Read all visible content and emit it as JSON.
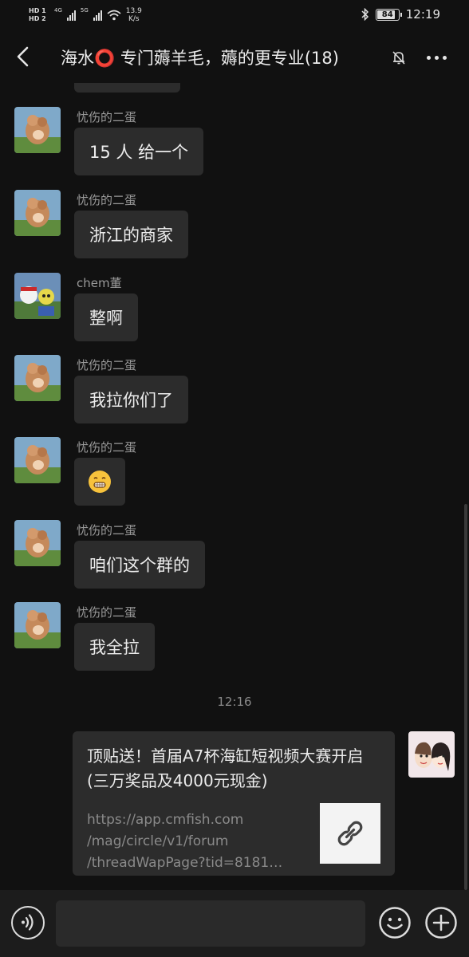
{
  "status_bar": {
    "sim1": "HD 1",
    "sim2": "HD 2",
    "net1": "4G",
    "net2": "5G",
    "speed_value": "13.9",
    "speed_unit": "K/s",
    "battery": "84",
    "time": "12:19"
  },
  "header": {
    "title": "海水⭕ 专门薅羊毛，薅的更专业(18)",
    "back_icon": "back-arrow-icon",
    "mute_icon": "bell-muted-icon",
    "more_icon": "more-dots-icon"
  },
  "messages": [
    {
      "sender": "忧伤的二蛋",
      "text": "15 人 给一个",
      "avatar": "teddy-avatar"
    },
    {
      "sender": "忧伤的二蛋",
      "text": "浙江的商家",
      "avatar": "teddy-avatar"
    },
    {
      "sender": "chem董",
      "text": "整啊",
      "avatar": "cartoon-avatar"
    },
    {
      "sender": "忧伤的二蛋",
      "text": "我拉你们了",
      "avatar": "teddy-avatar"
    },
    {
      "sender": "忧伤的二蛋",
      "text": "",
      "emoji": "grinning-face-emoji",
      "avatar": "teddy-avatar"
    },
    {
      "sender": "忧伤的二蛋",
      "text": "咱们这个群的",
      "avatar": "teddy-avatar"
    },
    {
      "sender": "忧伤的二蛋",
      "text": "我全拉",
      "avatar": "teddy-avatar"
    }
  ],
  "timestamp": "12:16",
  "link_card": {
    "title": "顶贴送！首届A7杯海缸短视频大赛开启(三万奖品及4000元现金)",
    "url_lines": [
      "https://app.cmfish.com",
      "/mag/circle/v1/forum",
      "/threadWapPage?tid=8181…"
    ],
    "thumb_icon": "link-icon"
  },
  "input_bar": {
    "voice_icon": "voice-icon",
    "emoji_icon": "emoji-icon",
    "plus_icon": "plus-icon",
    "placeholder": ""
  },
  "colors": {
    "background": "#111111",
    "bubble": "#2c2c2c",
    "text": "#ececec",
    "secondary_text": "#9a9a9a"
  }
}
